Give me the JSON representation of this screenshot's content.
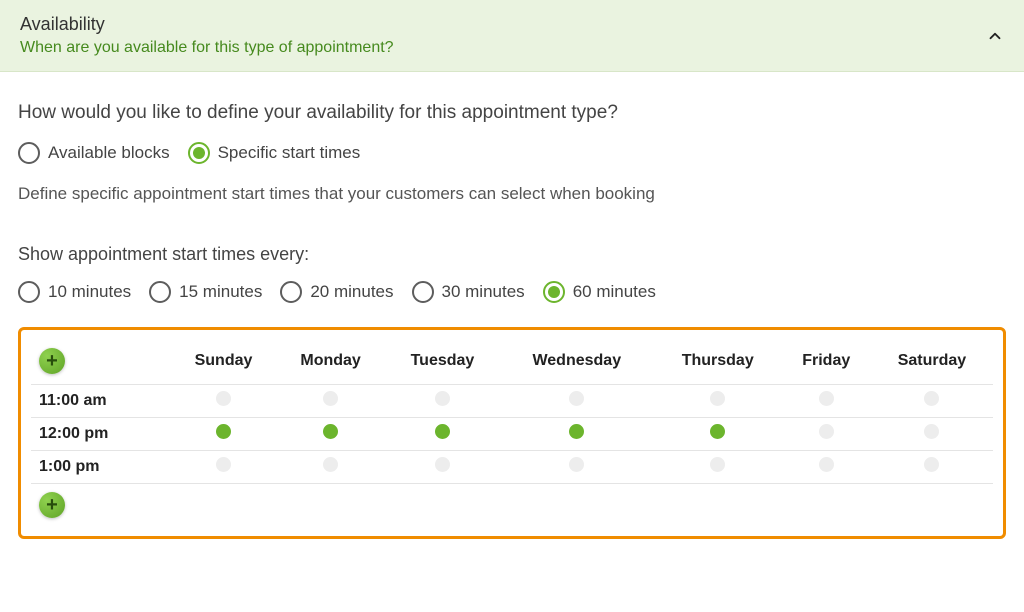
{
  "header": {
    "title": "Availability",
    "subtitle": "When are you available for this type of appointment?"
  },
  "question1": "How would you like to define your availability for this appointment type?",
  "availabilityMode": {
    "options": [
      {
        "label": "Available blocks",
        "selected": false
      },
      {
        "label": "Specific start times",
        "selected": true
      }
    ]
  },
  "description": "Define specific appointment start times that your customers can select when booking",
  "intervalHeading": "Show appointment start times every:",
  "intervals": {
    "options": [
      {
        "label": "10 minutes",
        "selected": false
      },
      {
        "label": "15 minutes",
        "selected": false
      },
      {
        "label": "20 minutes",
        "selected": false
      },
      {
        "label": "30 minutes",
        "selected": false
      },
      {
        "label": "60 minutes",
        "selected": true
      }
    ]
  },
  "schedule": {
    "days": [
      "Sunday",
      "Monday",
      "Tuesday",
      "Wednesday",
      "Thursday",
      "Friday",
      "Saturday"
    ],
    "rows": [
      {
        "time": "11:00 am",
        "cells": [
          false,
          false,
          false,
          false,
          false,
          false,
          false
        ]
      },
      {
        "time": "12:00 pm",
        "cells": [
          true,
          true,
          true,
          true,
          true,
          false,
          false
        ]
      },
      {
        "time": "1:00 pm",
        "cells": [
          false,
          false,
          false,
          false,
          false,
          false,
          false
        ]
      }
    ],
    "addLabel": "+"
  }
}
